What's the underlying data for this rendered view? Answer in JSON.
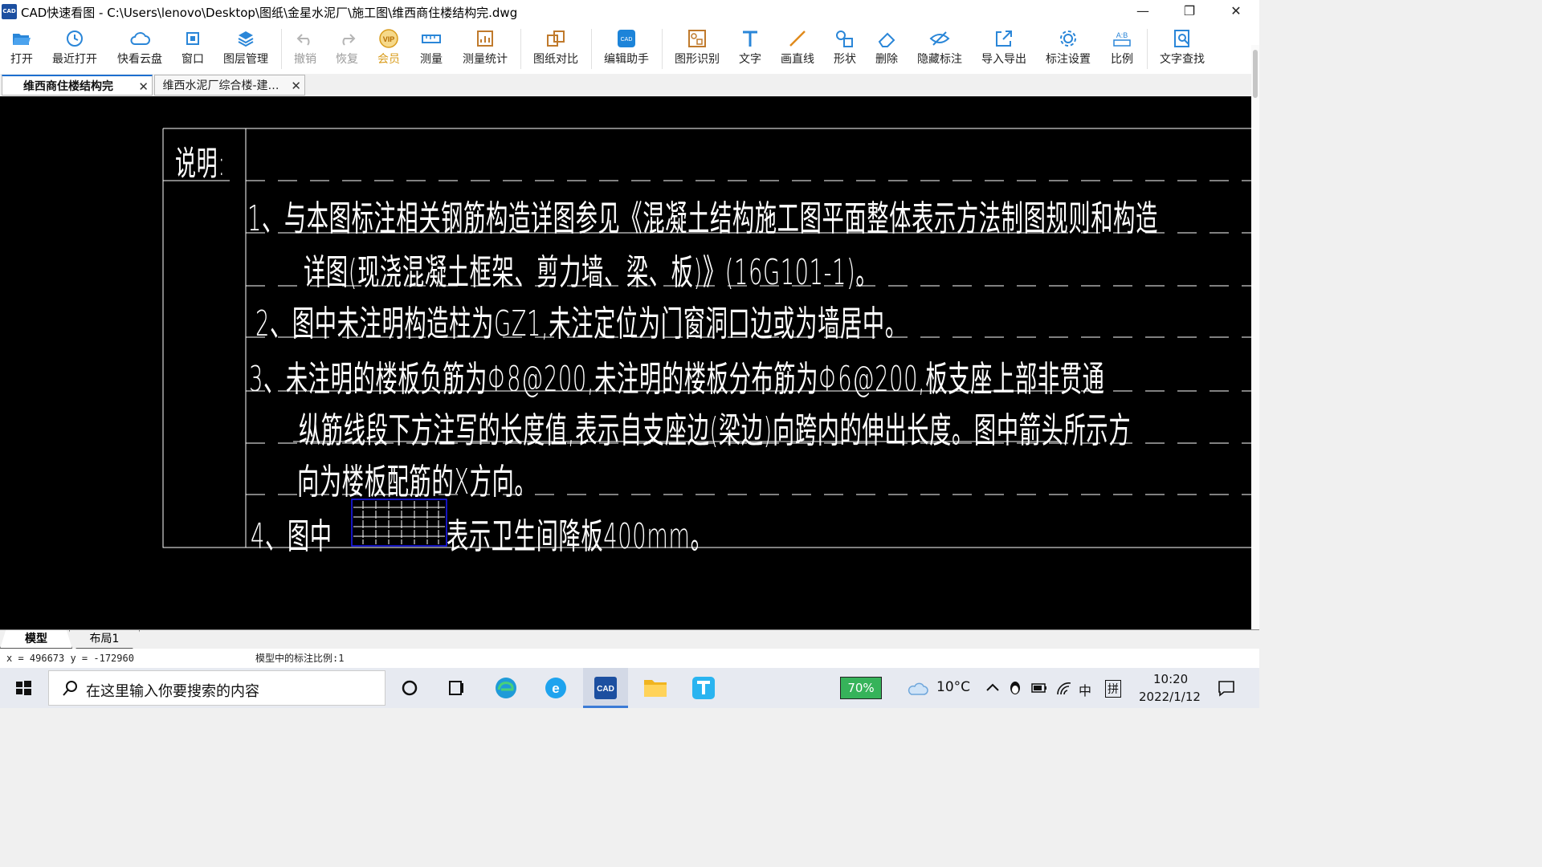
{
  "window": {
    "logo": "CAD",
    "title": "CAD快速看图 - C:\\Users\\lenovo\\Desktop\\图纸\\金星水泥厂\\施工图\\维西商住楼结构完.dwg",
    "minimize": "—",
    "restore": "❐",
    "close": "✕"
  },
  "toolbar": {
    "items": [
      {
        "label": "打开",
        "icon": "folder-open-icon",
        "enabled": true
      },
      {
        "label": "最近打开",
        "icon": "clock-icon",
        "enabled": true
      },
      {
        "label": "快看云盘",
        "icon": "cloud-icon",
        "enabled": true
      },
      {
        "label": "窗口",
        "icon": "window-icon",
        "enabled": true
      },
      {
        "label": "图层管理",
        "icon": "layers-icon",
        "enabled": true
      },
      {
        "label": "撤销",
        "icon": "undo-icon",
        "enabled": false
      },
      {
        "label": "恢复",
        "icon": "redo-icon",
        "enabled": false
      },
      {
        "label": "会员",
        "icon": "vip-icon",
        "enabled": true
      },
      {
        "label": "测量",
        "icon": "ruler-icon",
        "enabled": true
      },
      {
        "label": "测量统计",
        "icon": "measure-stats-icon",
        "enabled": true
      },
      {
        "label": "图纸对比",
        "icon": "compare-icon",
        "enabled": true
      },
      {
        "label": "编辑助手",
        "icon": "cad-edit-icon",
        "enabled": true
      },
      {
        "label": "图形识别",
        "icon": "shape-recognize-icon",
        "enabled": true
      },
      {
        "label": "文字",
        "icon": "text-icon",
        "enabled": true
      },
      {
        "label": "画直线",
        "icon": "line-icon",
        "enabled": true
      },
      {
        "label": "形状",
        "icon": "shapes-icon",
        "enabled": true
      },
      {
        "label": "删除",
        "icon": "eraser-icon",
        "enabled": true
      },
      {
        "label": "隐藏标注",
        "icon": "eye-hide-icon",
        "enabled": true
      },
      {
        "label": "导入导出",
        "icon": "import-export-icon",
        "enabled": true
      },
      {
        "label": "标注设置",
        "icon": "annotation-settings-icon",
        "enabled": true
      },
      {
        "label": "比例",
        "icon": "scale-icon",
        "enabled": true
      },
      {
        "label": "文字查找",
        "icon": "text-search-icon",
        "enabled": true
      }
    ]
  },
  "tabs": [
    {
      "label": "维西商住楼结构完",
      "close": "✕",
      "active": true
    },
    {
      "label": "维西水泥厂综合楼-建…",
      "close": "✕",
      "active": false
    }
  ],
  "drawing": {
    "heading": "说明:",
    "lines": [
      "1、与本图标注相关钢筋构造详图参见《混凝土结构施工图平面整体表示方法制图规则和构造",
      "详图(现浇混凝土框架、剪力墙、梁、板)》(16G101-1)。",
      "2、图中未注明构造柱为GZ1,未注定位为门窗洞口边或为墙居中。",
      "3、未注明的楼板负筋为Φ8@200,未注明的楼板分布筋为Φ6@200,板支座上部非贯通",
      "纵筋线段下方注写的长度值,表示自支座边(梁边)向跨内的伸出长度。图中箭头所示方",
      "向为楼板配筋的X方向。"
    ],
    "line4_prefix": "4、图中",
    "line4_suffix": "表示卫生间降板400mm。"
  },
  "layout_tabs": [
    {
      "label": "模型",
      "active": true
    },
    {
      "label": "布局1",
      "active": false
    }
  ],
  "status": {
    "coords": "x = 496673 y = -172960",
    "scale": "模型中的标注比例:1"
  },
  "taskbar": {
    "search_placeholder": "在这里输入你要搜索的内容",
    "battery_widget": "70%",
    "weather": "10°C",
    "ime_lang": "中",
    "ime_mode": "拼",
    "time": "10:20",
    "date": "2022/1/12"
  },
  "colors": {
    "canvas": "#000000",
    "drawing_lines": "#ffffff",
    "hatch_box": "#1a1aff",
    "accent": "#1d6fd0"
  }
}
